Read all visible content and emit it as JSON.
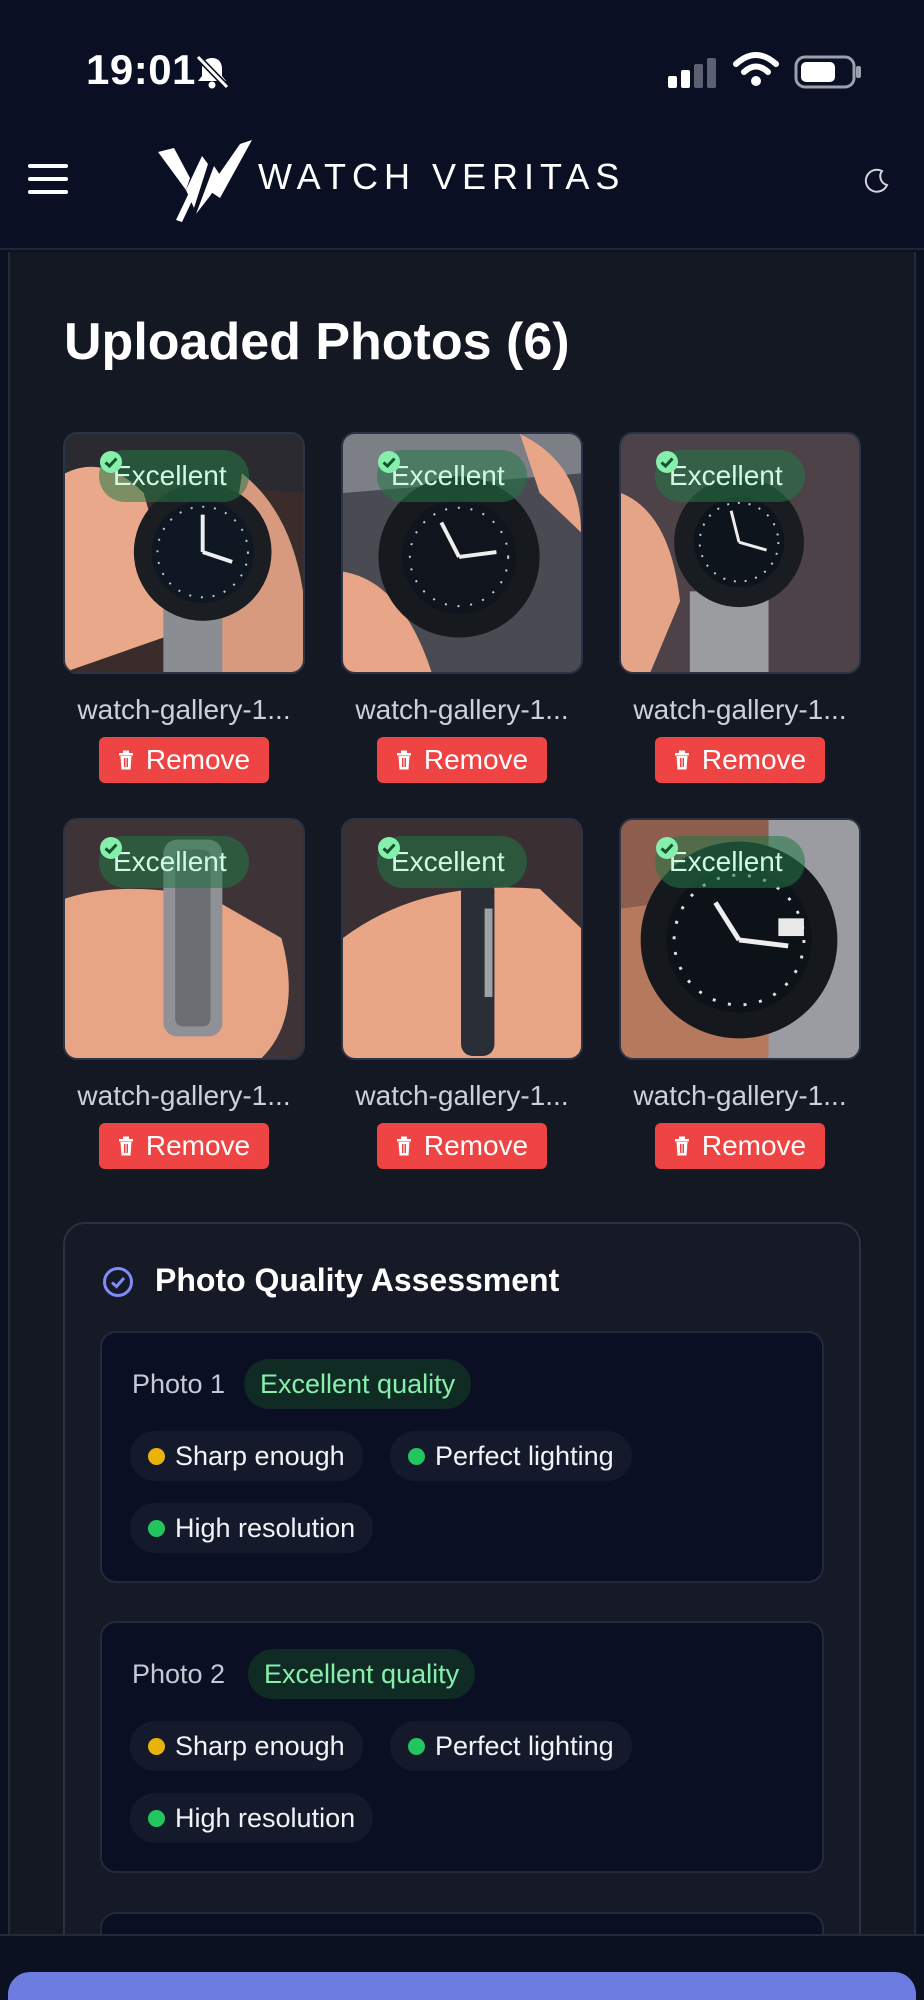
{
  "status_bar": {
    "time": "19:01"
  },
  "header": {
    "brand": "WATCH VERITAS",
    "menu_icon": "hamburger-menu-icon",
    "theme_icon": "moon-icon"
  },
  "uploads": {
    "title": "Uploaded Photos (6)",
    "photos": [
      {
        "badge": "Excellent",
        "filename": "watch-gallery-1...",
        "remove_label": "Remove"
      },
      {
        "badge": "Excellent",
        "filename": "watch-gallery-1...",
        "remove_label": "Remove"
      },
      {
        "badge": "Excellent",
        "filename": "watch-gallery-1...",
        "remove_label": "Remove"
      },
      {
        "badge": "Excellent",
        "filename": "watch-gallery-1...",
        "remove_label": "Remove"
      },
      {
        "badge": "Excellent",
        "filename": "watch-gallery-1...",
        "remove_label": "Remove"
      },
      {
        "badge": "Excellent",
        "filename": "watch-gallery-1...",
        "remove_label": "Remove"
      }
    ]
  },
  "assessment": {
    "title": "Photo Quality Assessment",
    "items": [
      {
        "label": "Photo 1",
        "quality": "Excellent quality",
        "checks": [
          {
            "text": "Sharp enough",
            "status": "warning"
          },
          {
            "text": "Perfect lighting",
            "status": "good"
          },
          {
            "text": "High resolution",
            "status": "good"
          }
        ]
      },
      {
        "label": "Photo 2",
        "quality": "Excellent quality",
        "checks": [
          {
            "text": "Sharp enough",
            "status": "warning"
          },
          {
            "text": "Perfect lighting",
            "status": "good"
          },
          {
            "text": "High resolution",
            "status": "good"
          }
        ]
      }
    ]
  },
  "colors": {
    "background": "#0c1122",
    "remove_button": "#ef4444",
    "badge_text": "#86efac",
    "dot_warning": "#eab308",
    "dot_good": "#22c55e",
    "accent": "#6d7ce0"
  }
}
